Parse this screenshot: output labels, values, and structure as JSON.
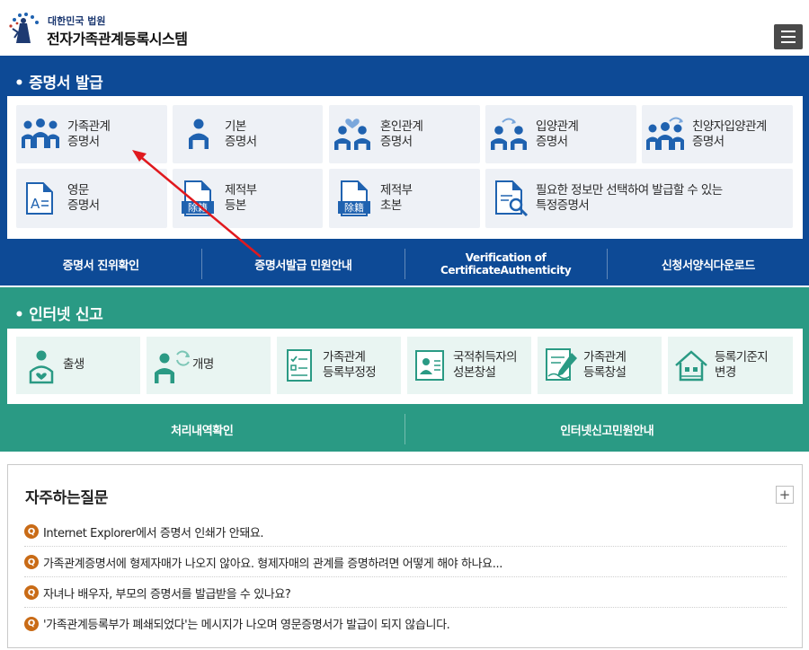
{
  "header": {
    "org": "대한민국 법원",
    "system_name": "전자가족관계등록시스템"
  },
  "cert_section": {
    "title": "• 증명서 발급",
    "cards": [
      {
        "label": "가족관계\n증명서",
        "icon": "family-icon"
      },
      {
        "label": "기본\n증명서",
        "icon": "person-icon"
      },
      {
        "label": "혼인관계\n증명서",
        "icon": "couple-heart-icon"
      },
      {
        "label": "입양관계\n증명서",
        "icon": "adoption-icon"
      },
      {
        "label": "친양자입양관계\n증명서",
        "icon": "family-adoption-icon"
      },
      {
        "label": "영문\n증명서",
        "icon": "english-document-icon"
      },
      {
        "label": "제적부\n등본",
        "icon": "removed-register-icon"
      },
      {
        "label": "제적부\n초본",
        "icon": "removed-register-icon"
      },
      {
        "label": "필요한 정보만 선택하여 발급할 수 있는\n특정증명서",
        "icon": "document-search-icon"
      }
    ],
    "badge_text": "除籍",
    "english_badge": "A",
    "links": [
      "증명서 진위확인",
      "증명서발급 민원안내",
      "Verification of CertificateAuthenticity",
      "신청서양식다운로드"
    ]
  },
  "report_section": {
    "title": "• 인터넷 신고",
    "cards": [
      {
        "label": "출생",
        "icon": "birth-icon"
      },
      {
        "label": "개명",
        "icon": "rename-icon"
      },
      {
        "label": "가족관계\n등록부정정",
        "icon": "correction-form-icon"
      },
      {
        "label": "국적취득자의\n성본창설",
        "icon": "id-card-icon"
      },
      {
        "label": "가족관계\n등록창설",
        "icon": "register-create-icon"
      },
      {
        "label": "등록기준지\n변경",
        "icon": "house-icon"
      }
    ],
    "links": [
      "처리내역확인",
      "인터넷신고민원안내"
    ]
  },
  "faq": {
    "title": "자주하는질문",
    "plus": "+",
    "badge": "Q",
    "items": [
      "Internet Explorer에서 증명서 인쇄가 안돼요.",
      "가족관계증명서에 형제자매가 나오지 않아요. 형제자매의 관계를 증명하려면 어떻게 해야 하나요...",
      "자녀나 배우자, 부모의 증명서를 발급받을 수 있나요?",
      "'가족관계등록부가 폐쇄되었다'는 메시지가 나오며 영문증명서가 발급이 되지 않습니다."
    ]
  },
  "colors": {
    "blue": "#0d4a96",
    "teal": "#2a9a84",
    "icon_blue": "#1f62b0",
    "icon_teal": "#2a9a84",
    "q_badge": "#c96b16",
    "arrow": "#e0191e"
  }
}
